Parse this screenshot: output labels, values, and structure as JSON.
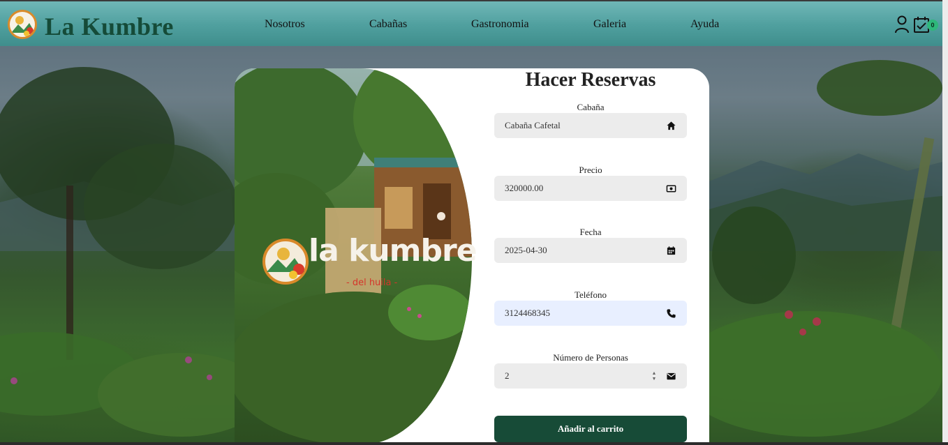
{
  "header": {
    "brand": "La Kumbre",
    "nav": [
      "Nosotros",
      "Cabañas",
      "Gastronomia",
      "Galeria",
      "Ayuda"
    ],
    "cart_count": "0"
  },
  "photo_logo": {
    "text": "la kumbre",
    "subtitle": "- del huila -"
  },
  "form": {
    "title": "Hacer Reservas",
    "fields": [
      {
        "label": "Cabaña",
        "value": "Cabaña Cafetal",
        "icon": "home-icon"
      },
      {
        "label": "Precio",
        "value": "320000.00",
        "icon": "money-icon"
      },
      {
        "label": "Fecha",
        "value": "2025-04-30",
        "icon": "calendar-icon"
      },
      {
        "label": "Teléfono",
        "value": "3124468345",
        "icon": "phone-icon"
      },
      {
        "label": "Número de Personas",
        "value": "2",
        "icon": "mail-icon"
      }
    ],
    "submit_label": "Añadir al carrito"
  },
  "colors": {
    "header": "#4f9f9e",
    "brand": "#154b38",
    "button": "#174b37",
    "field_bg": "#ececec",
    "field_active": "#e8efff",
    "badge": "#2eb87a"
  }
}
